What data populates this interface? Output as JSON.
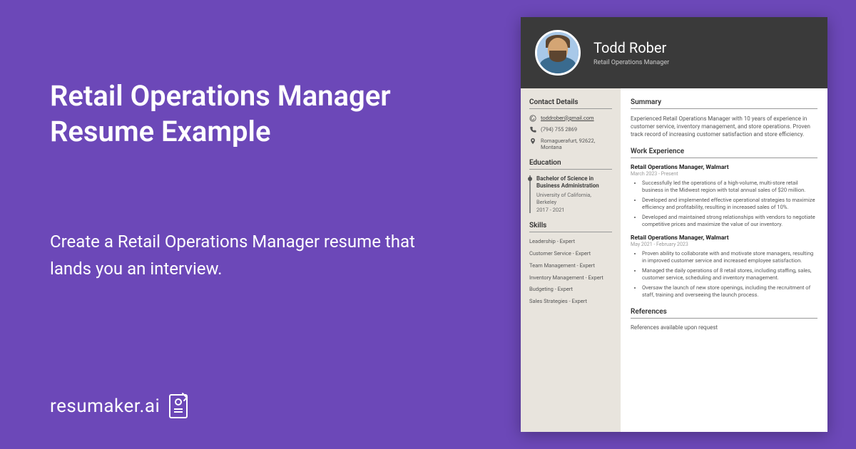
{
  "hero": {
    "title": "Retail Operations Manager Resume Example",
    "subtitle": "Create a Retail Operations Manager resume that lands you an interview."
  },
  "brand": {
    "name": "resumaker.ai"
  },
  "resume": {
    "name": "Todd Rober",
    "role": "Retail Operations Manager",
    "contact": {
      "title": "Contact Details",
      "email": "toddrober@gmail.com",
      "phone": "(794) 755 2869",
      "address": "Romaguerafurt, 92622, Montana"
    },
    "education": {
      "title": "Education",
      "degree": "Bachelor of Science in Business Administration",
      "school": "University of California, Berkeley",
      "dates": "2017 - 2021"
    },
    "skills": {
      "title": "Skills",
      "items": [
        "Leadership - Expert",
        "Customer Service - Expert",
        "Team Management - Expert",
        "Inventory Management - Expert",
        "Budgeting - Expert",
        "Sales Strategies - Expert"
      ]
    },
    "summary": {
      "title": "Summary",
      "text": "Experienced Retail Operations Manager with 10 years of experience in customer service, inventory management, and store operations. Proven track record of increasing customer satisfaction and store efficiency."
    },
    "experience": {
      "title": "Work Experience",
      "jobs": [
        {
          "title": "Retail Operations Manager, Walmart",
          "dates": "March 2023 - Present",
          "bullets": [
            "Successfully led the operations of a high-volume, multi-store retail business in the Midwest region with total annual sales of $20 million.",
            "Developed and implemented effective operational strategies to maximize efficiency and profitability, resulting in increased sales of 10%.",
            "Developed and maintained strong relationships with vendors to negotiate competitive prices and maximize the value of our inventory."
          ]
        },
        {
          "title": "Retail Operations Manager, Walmart",
          "dates": "May 2021 - February 2023",
          "bullets": [
            "Proven ability to collaborate with and motivate store managers, resulting in improved customer service and increased employee satisfaction.",
            "Managed the daily operations of 8 retail stores, including staffing, sales, customer service, scheduling and inventory management.",
            "Oversaw the launch of new store openings, including the recruitment of staff, training and overseeing the launch process."
          ]
        }
      ]
    },
    "references": {
      "title": "References",
      "text": "References available upon request"
    }
  }
}
